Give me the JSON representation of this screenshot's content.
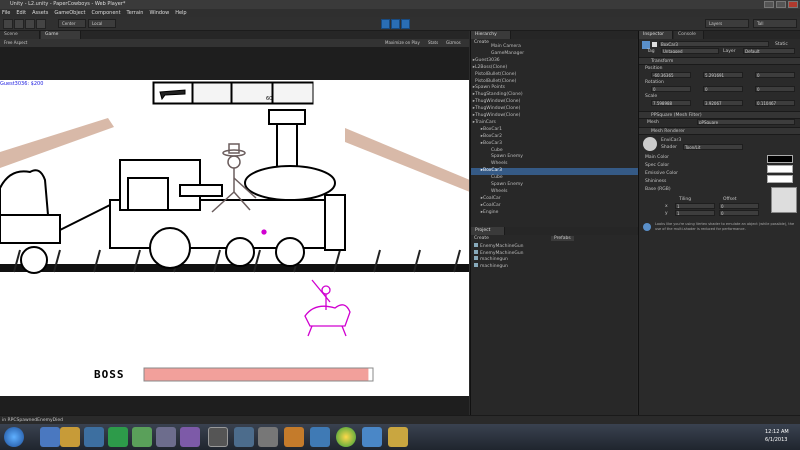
{
  "window": {
    "title": "Unity - L2.unity - PaperCowboys - Web Player*"
  },
  "menu": [
    "File",
    "Edit",
    "Assets",
    "GameObject",
    "Component",
    "Terrain",
    "Window",
    "Help"
  ],
  "toolbar": {
    "center_label": "Center",
    "local_label": "Local",
    "layers": "Layers",
    "layout": "Tall"
  },
  "scene_tab": "Scene",
  "game_tab": "Game",
  "game_toolbar": {
    "aspect": "Free Aspect",
    "maximize": "Maximize on Play",
    "stats": "Stats",
    "gizmos": "Gizmos"
  },
  "game": {
    "player_label": "Guest3036: $200",
    "boss_label": "BOSS",
    "boss_health": 0.98,
    "ammo": "60"
  },
  "hierarchy": {
    "tab": "Hierarchy",
    "create": "Create",
    "items": [
      {
        "label": "Main Camera",
        "indent": 2,
        "arrow": false
      },
      {
        "label": "GameManager",
        "indent": 2,
        "arrow": false
      },
      {
        "label": "Guest3036",
        "indent": 0,
        "arrow": true
      },
      {
        "label": "L2Boss(Clone)",
        "indent": 0,
        "arrow": true
      },
      {
        "label": "PistolBullet(Clone)",
        "indent": 0,
        "arrow": false
      },
      {
        "label": "PistolBullet(Clone)",
        "indent": 0,
        "arrow": false
      },
      {
        "label": "Spawn Points",
        "indent": 0,
        "arrow": true
      },
      {
        "label": "ThugStanding(Clone)",
        "indent": 0,
        "arrow": true
      },
      {
        "label": "ThugWindow(Clone)",
        "indent": 0,
        "arrow": true
      },
      {
        "label": "ThugWindow(Clone)",
        "indent": 0,
        "arrow": true
      },
      {
        "label": "ThugWindow(Clone)",
        "indent": 0,
        "arrow": true
      },
      {
        "label": "TrainCars",
        "indent": 0,
        "arrow": true
      },
      {
        "label": "BoxCar1",
        "indent": 1,
        "arrow": true
      },
      {
        "label": "BoxCar2",
        "indent": 1,
        "arrow": true
      },
      {
        "label": "BoxCar3",
        "indent": 1,
        "arrow": true
      },
      {
        "label": "Cube",
        "indent": 2,
        "arrow": false
      },
      {
        "label": "Spawn Enemy",
        "indent": 2,
        "arrow": false
      },
      {
        "label": "Wheels",
        "indent": 2,
        "arrow": false
      },
      {
        "label": "BoxCar3",
        "indent": 1,
        "arrow": true,
        "selected": true
      },
      {
        "label": "Cube",
        "indent": 2,
        "arrow": false
      },
      {
        "label": "Spawn Enemy",
        "indent": 2,
        "arrow": false
      },
      {
        "label": "Wheels",
        "indent": 2,
        "arrow": false
      },
      {
        "label": "CoalCar",
        "indent": 1,
        "arrow": true
      },
      {
        "label": "CoalCar",
        "indent": 1,
        "arrow": true
      },
      {
        "label": "Engine",
        "indent": 1,
        "arrow": true
      }
    ]
  },
  "project": {
    "tab": "Project",
    "create": "Create",
    "search": "Prefabs",
    "items": [
      "EnemyMachineGun",
      "EnemyMachineGun",
      "machinegun",
      "machinegun"
    ],
    "path": "Path:"
  },
  "inspector": {
    "tab": "Inspector",
    "console_tab": "Console",
    "object_name": "BoxCar3",
    "static": "Static",
    "tag_label": "Tag",
    "tag_value": "Untagged",
    "layer_label": "Layer",
    "layer_value": "Default",
    "transform": {
      "title": "Transform",
      "position_label": "Position",
      "rotation_label": "Rotation",
      "scale_label": "Scale",
      "position": {
        "x": "-60.36365",
        "y": "5.291691",
        "z": "0"
      },
      "rotation": {
        "x": "0",
        "y": "0",
        "z": "0"
      },
      "scale": {
        "x": "7.598988",
        "y": "3.92067",
        "z": "0.110467"
      }
    },
    "mesh_filter": {
      "title": "PPSquare (Mesh Filter)",
      "mesh_label": "Mesh",
      "mesh_value": "pPSquare"
    },
    "mesh_renderer": {
      "title": "Mesh Renderer"
    },
    "material": {
      "name": "EnviCar3",
      "shader_label": "Shader",
      "shader_value": "Toon/Lit",
      "props": [
        "Main Color",
        "Spec Color",
        "Emissive Color",
        "Shininess",
        "Base (RGB)"
      ],
      "tiling": "Tiling",
      "offset": "Offset",
      "x": "x",
      "y": "y",
      "t_x": "1",
      "t_y": "1",
      "o_x": "0",
      "o_y": "0"
    },
    "warning": "Looks like you're using Vertex shader to emulate an object (while possible), the use of the multi-shader is reduced for performance."
  },
  "status": {
    "message": "in RPCSpawnedEnemyDied"
  },
  "taskbar": {
    "time": "12:12 AM",
    "date": "6/1/2013"
  },
  "colors": {
    "selection": "#355a86",
    "play": "#2a6eb5",
    "boss_bar": "#f2a09b"
  }
}
